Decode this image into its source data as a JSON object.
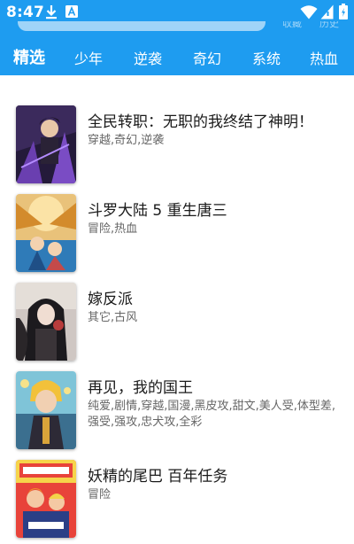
{
  "status_bar": {
    "time": "8:47",
    "icons": [
      "download-icon",
      "a-notification-icon",
      "wifi-icon",
      "signal-icon",
      "battery-icon"
    ]
  },
  "header": {
    "background": "#1e9cf0",
    "overlap_labels": [
      "収藏",
      "历史"
    ]
  },
  "tabs": [
    {
      "label": "精选",
      "active": true
    },
    {
      "label": "少年",
      "active": false
    },
    {
      "label": "逆袭",
      "active": false
    },
    {
      "label": "奇幻",
      "active": false
    },
    {
      "label": "系统",
      "active": false
    },
    {
      "label": "热血",
      "active": false
    }
  ],
  "books": [
    {
      "title": "全民转职：无职的我终结了神明！",
      "tags": "穿越,奇幻,逆袭"
    },
    {
      "title": "斗罗大陆 5 重生唐三",
      "tags": "冒险,热血"
    },
    {
      "title": "嫁反派",
      "tags": "其它,古风"
    },
    {
      "title": "再见，我的国王",
      "tags": "纯爱,剧情,穿越,国漫,黑皮攻,甜文,美人受,体型差,强受,强攻,忠犬攻,全彩"
    },
    {
      "title": "妖精的尾巴 百年任务",
      "tags": "冒险"
    }
  ]
}
